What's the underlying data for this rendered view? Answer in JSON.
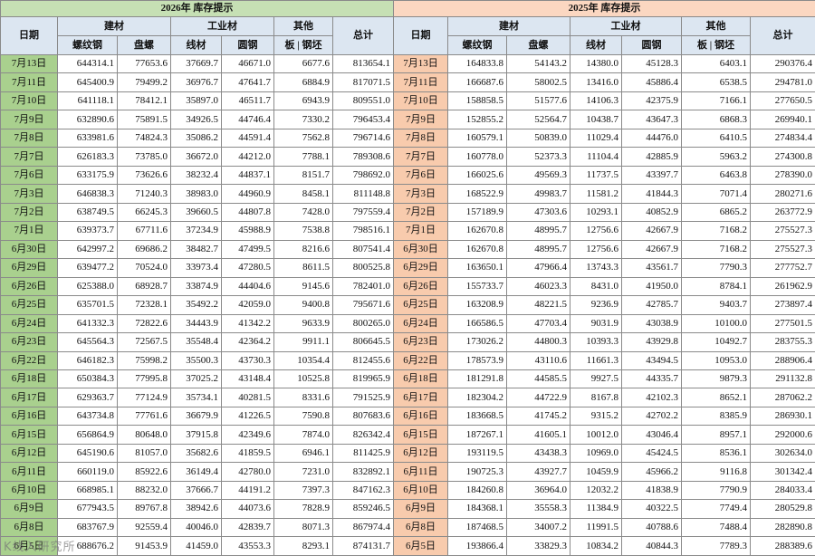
{
  "titles": {
    "y2026": "2026年  库存提示",
    "y2025": "2025年  库存提示"
  },
  "headers": {
    "date": "日期",
    "group_construction": "建材",
    "group_industrial": "工业材",
    "group_other": "其他",
    "total": "总计",
    "rebar": "螺纹钢",
    "coil": "盘螺",
    "wire": "线材",
    "round": "圆钢",
    "plate": "板",
    "billet": "钢坯"
  },
  "watermark": "K线入研究所",
  "rows2026": [
    {
      "date": "7月13日",
      "v": [
        "644314.1",
        "77653.6",
        "37669.7",
        "46671.0",
        "6677.6",
        "813654.1"
      ]
    },
    {
      "date": "7月11日",
      "v": [
        "645400.9",
        "79499.2",
        "36976.7",
        "47641.7",
        "6884.9",
        "817071.5"
      ]
    },
    {
      "date": "7月10日",
      "v": [
        "641118.1",
        "78412.1",
        "35897.0",
        "46511.7",
        "6943.9",
        "809551.0"
      ]
    },
    {
      "date": "7月9日",
      "v": [
        "632890.6",
        "75891.5",
        "34926.5",
        "44746.4",
        "7330.2",
        "796453.4"
      ]
    },
    {
      "date": "7月8日",
      "v": [
        "633981.6",
        "74824.3",
        "35086.2",
        "44591.4",
        "7562.8",
        "796714.6"
      ]
    },
    {
      "date": "7月7日",
      "v": [
        "626183.3",
        "73785.0",
        "36672.0",
        "44212.0",
        "7788.1",
        "789308.6"
      ]
    },
    {
      "date": "7月6日",
      "v": [
        "633175.9",
        "73626.6",
        "38232.4",
        "44837.1",
        "8151.7",
        "798692.0"
      ]
    },
    {
      "date": "7月3日",
      "v": [
        "646838.3",
        "71240.3",
        "38983.0",
        "44960.9",
        "8458.1",
        "811148.8"
      ]
    },
    {
      "date": "7月2日",
      "v": [
        "638749.5",
        "66245.3",
        "39660.5",
        "44807.8",
        "7428.0",
        "797559.4"
      ]
    },
    {
      "date": "7月1日",
      "v": [
        "639373.7",
        "67711.6",
        "37234.9",
        "45988.9",
        "7538.8",
        "798516.1"
      ]
    },
    {
      "date": "6月30日",
      "v": [
        "642997.2",
        "69686.2",
        "38482.7",
        "47499.5",
        "8216.6",
        "807541.4"
      ]
    },
    {
      "date": "6月29日",
      "v": [
        "639477.2",
        "70524.0",
        "33973.4",
        "47280.5",
        "8611.5",
        "800525.8"
      ]
    },
    {
      "date": "6月26日",
      "v": [
        "625388.0",
        "68928.7",
        "33874.9",
        "44404.6",
        "9145.6",
        "782401.0"
      ]
    },
    {
      "date": "6月25日",
      "v": [
        "635701.5",
        "72328.1",
        "35492.2",
        "42059.0",
        "9400.8",
        "795671.6"
      ]
    },
    {
      "date": "6月24日",
      "v": [
        "641332.3",
        "72822.6",
        "34443.9",
        "41342.2",
        "9633.9",
        "800265.0"
      ]
    },
    {
      "date": "6月23日",
      "v": [
        "645564.3",
        "72567.5",
        "35548.4",
        "42364.2",
        "9911.1",
        "806645.5"
      ]
    },
    {
      "date": "6月22日",
      "v": [
        "646182.3",
        "75998.2",
        "35500.3",
        "43730.3",
        "10354.4",
        "812455.6"
      ]
    },
    {
      "date": "6月18日",
      "v": [
        "650384.3",
        "77995.8",
        "37025.2",
        "43148.4",
        "10525.8",
        "819965.9"
      ]
    },
    {
      "date": "6月17日",
      "v": [
        "629363.7",
        "77124.9",
        "35734.1",
        "40281.5",
        "8331.6",
        "791525.9"
      ]
    },
    {
      "date": "6月16日",
      "v": [
        "643734.8",
        "77761.6",
        "36679.9",
        "41226.5",
        "7590.8",
        "807683.6"
      ]
    },
    {
      "date": "6月15日",
      "v": [
        "656864.9",
        "80648.0",
        "37915.8",
        "42349.6",
        "7874.0",
        "826342.4"
      ]
    },
    {
      "date": "6月12日",
      "v": [
        "645190.6",
        "81057.0",
        "35682.6",
        "41859.5",
        "6946.1",
        "811425.9"
      ]
    },
    {
      "date": "6月11日",
      "v": [
        "660119.0",
        "85922.6",
        "36149.4",
        "42780.0",
        "7231.0",
        "832892.1"
      ]
    },
    {
      "date": "6月10日",
      "v": [
        "668985.1",
        "88232.0",
        "37666.7",
        "44191.2",
        "7397.3",
        "847162.3"
      ]
    },
    {
      "date": "6月9日",
      "v": [
        "677943.5",
        "89767.8",
        "38942.6",
        "44073.6",
        "7828.9",
        "859246.5"
      ]
    },
    {
      "date": "6月8日",
      "v": [
        "683767.9",
        "92559.4",
        "40046.0",
        "42839.7",
        "8071.3",
        "867974.4"
      ]
    },
    {
      "date": "6月5日",
      "v": [
        "688676.2",
        "91453.9",
        "41459.0",
        "43553.3",
        "8293.1",
        "874131.7"
      ]
    }
  ],
  "rows2025": [
    {
      "date": "7月13日",
      "v": [
        "164833.8",
        "54143.2",
        "14380.0",
        "45128.3",
        "6403.1",
        "290376.4"
      ]
    },
    {
      "date": "7月11日",
      "v": [
        "166687.6",
        "58002.5",
        "13416.0",
        "45886.4",
        "6538.5",
        "294781.0"
      ]
    },
    {
      "date": "7月10日",
      "v": [
        "158858.5",
        "51577.6",
        "14106.3",
        "42375.9",
        "7166.1",
        "277650.5"
      ]
    },
    {
      "date": "7月9日",
      "v": [
        "152855.2",
        "52564.7",
        "10438.7",
        "43647.3",
        "6868.3",
        "269940.1"
      ]
    },
    {
      "date": "7月8日",
      "v": [
        "160579.1",
        "50839.0",
        "11029.4",
        "44476.0",
        "6410.5",
        "274834.4"
      ]
    },
    {
      "date": "7月7日",
      "v": [
        "160778.0",
        "52373.3",
        "11104.4",
        "42885.9",
        "5963.2",
        "274300.8"
      ]
    },
    {
      "date": "7月6日",
      "v": [
        "166025.6",
        "49569.3",
        "11737.5",
        "43397.7",
        "6463.8",
        "278390.0"
      ]
    },
    {
      "date": "7月3日",
      "v": [
        "168522.9",
        "49983.7",
        "11581.2",
        "41844.3",
        "7071.4",
        "280271.6"
      ]
    },
    {
      "date": "7月2日",
      "v": [
        "157189.9",
        "47303.6",
        "10293.1",
        "40852.9",
        "6865.2",
        "263772.9"
      ]
    },
    {
      "date": "7月1日",
      "v": [
        "162670.8",
        "48995.7",
        "12756.6",
        "42667.9",
        "7168.2",
        "275527.3"
      ]
    },
    {
      "date": "6月30日",
      "v": [
        "162670.8",
        "48995.7",
        "12756.6",
        "42667.9",
        "7168.2",
        "275527.3"
      ]
    },
    {
      "date": "6月29日",
      "v": [
        "163650.1",
        "47966.4",
        "13743.3",
        "43561.7",
        "7790.3",
        "277752.7"
      ]
    },
    {
      "date": "6月26日",
      "v": [
        "155733.7",
        "46023.3",
        "8431.0",
        "41950.0",
        "8784.1",
        "261962.9"
      ]
    },
    {
      "date": "6月25日",
      "v": [
        "163208.9",
        "48221.5",
        "9236.9",
        "42785.7",
        "9403.7",
        "273897.4"
      ]
    },
    {
      "date": "6月24日",
      "v": [
        "166586.5",
        "47703.4",
        "9031.9",
        "43038.9",
        "10100.0",
        "277501.5"
      ]
    },
    {
      "date": "6月23日",
      "v": [
        "173026.2",
        "44800.3",
        "10393.3",
        "43929.8",
        "10492.7",
        "283755.3"
      ]
    },
    {
      "date": "6月22日",
      "v": [
        "178573.9",
        "43110.6",
        "11661.3",
        "43494.5",
        "10953.0",
        "288906.4"
      ]
    },
    {
      "date": "6月18日",
      "v": [
        "181291.8",
        "44585.5",
        "9927.5",
        "44335.7",
        "9879.3",
        "291132.8"
      ]
    },
    {
      "date": "6月17日",
      "v": [
        "182304.2",
        "44722.9",
        "8167.8",
        "42102.3",
        "8652.1",
        "287062.2"
      ]
    },
    {
      "date": "6月16日",
      "v": [
        "183668.5",
        "41745.2",
        "9315.2",
        "42702.2",
        "8385.9",
        "286930.1"
      ]
    },
    {
      "date": "6月15日",
      "v": [
        "187267.1",
        "41605.1",
        "10012.0",
        "43046.4",
        "8957.1",
        "292000.6"
      ]
    },
    {
      "date": "6月12日",
      "v": [
        "193119.5",
        "43438.3",
        "10969.0",
        "45424.5",
        "8536.1",
        "302634.0"
      ]
    },
    {
      "date": "6月11日",
      "v": [
        "190725.3",
        "43927.7",
        "10459.9",
        "45966.2",
        "9116.8",
        "301342.4"
      ]
    },
    {
      "date": "6月10日",
      "v": [
        "184260.8",
        "36964.0",
        "12032.2",
        "41838.9",
        "7790.9",
        "284033.4"
      ]
    },
    {
      "date": "6月9日",
      "v": [
        "184368.1",
        "35558.3",
        "11384.9",
        "40322.5",
        "7749.4",
        "280529.8"
      ]
    },
    {
      "date": "6月8日",
      "v": [
        "187468.5",
        "34007.2",
        "11991.5",
        "40788.6",
        "7488.4",
        "282890.8"
      ]
    },
    {
      "date": "6月5日",
      "v": [
        "193866.4",
        "33829.3",
        "10834.2",
        "40844.3",
        "7789.3",
        "288389.6"
      ]
    }
  ]
}
